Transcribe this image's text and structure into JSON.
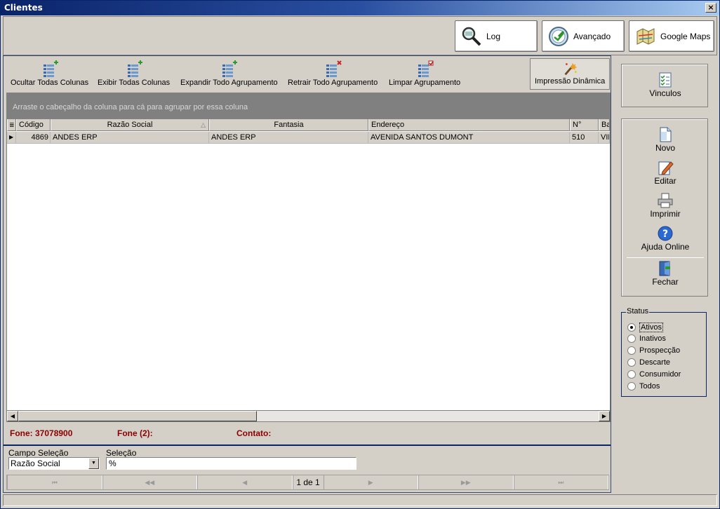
{
  "window": {
    "title": "Clientes",
    "close": "×"
  },
  "topbuttons": [
    {
      "label": "Log",
      "icon": "magnifier-icon"
    },
    {
      "label": "Avançado",
      "icon": "compass-icon"
    },
    {
      "label": "Google Maps",
      "icon": "map-icon"
    }
  ],
  "toolbar": {
    "hide_all": "Ocultar Todas Colunas",
    "show_all": "Exibir Todas  Colunas",
    "expand_all": "Expandir Todo Agrupamento",
    "collapse_all": "Retrair Todo Agrupamento",
    "clear_group": "Limpar Agrupamento",
    "dynamic_print": "Impressão Dinâmica"
  },
  "grid": {
    "group_hint": "Arraste o cabeçalho da coluna para cá para agrupar por essa coluna",
    "columns": [
      "Código",
      "Razão Social",
      "Fantasia",
      "Endereço",
      "N°",
      "Ba"
    ],
    "rows": [
      {
        "codigo": "4869",
        "razao": "ANDES ERP",
        "fantasia": "ANDES ERP",
        "endereco": "AVENIDA SANTOS DUMONT",
        "numero": "510",
        "bairro": "VIL"
      }
    ]
  },
  "info": {
    "fone": "Fone: 37078900",
    "fone2": "Fone (2):",
    "contato": "Contato:"
  },
  "filter": {
    "campo_label": "Campo Seleção",
    "campo_value": "Razão Social",
    "selecao_label": "Seleção",
    "selecao_value": "%"
  },
  "pager": {
    "first": "⏮",
    "prev_page": "◀◀",
    "prev": "◀",
    "label": "1 de 1",
    "next": "▶",
    "next_page": "▶▶",
    "last": "⏭"
  },
  "sidebar": {
    "vinculos": "Vinculos",
    "novo": "Novo",
    "editar": "Editar",
    "imprimir": "Imprimir",
    "ajuda": "Ajuda Online",
    "fechar": "Fechar"
  },
  "status": {
    "legend": "Status",
    "options": [
      "Ativos",
      "Inativos",
      "Prospecção",
      "Descarte",
      "Consumidor",
      "Todos"
    ],
    "selected": "Ativos"
  }
}
